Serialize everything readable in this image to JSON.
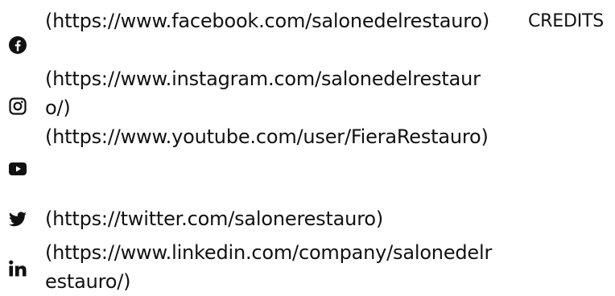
{
  "social_links": [
    {
      "network": "facebook",
      "icon": "facebook-icon",
      "text": "(https://www.facebook.com/salonedelrestauro)"
    },
    {
      "network": "instagram",
      "icon": "instagram-icon",
      "text": "(https://www.instagram.com/salonedelrestauro/)"
    },
    {
      "network": "youtube",
      "icon": "youtube-icon",
      "text": "(https://www.youtube.com/user/FieraRestauro)"
    },
    {
      "network": "twitter",
      "icon": "twitter-icon",
      "text": "(https://twitter.com/salonerestauro)"
    },
    {
      "network": "linkedin",
      "icon": "linkedin-icon",
      "text": "(https://www.linkedin.com/company/salonedelrestauro/)"
    }
  ],
  "credits_label": "CREDITS",
  "colors": {
    "text": "#111111",
    "background": "#ffffff"
  }
}
